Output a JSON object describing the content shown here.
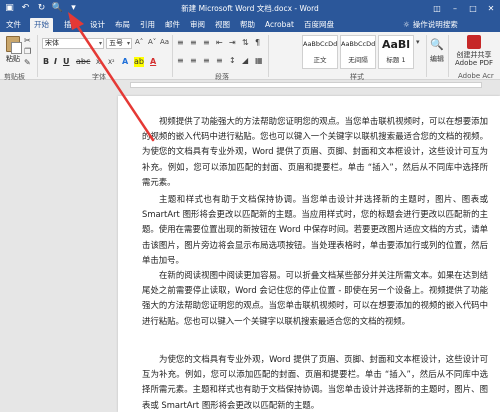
{
  "titlebar": {
    "title": "新建 Microsoft Word 文档.docx - Word",
    "qat": [
      "save-icon",
      "undo-icon",
      "redo-icon",
      "print-preview-icon",
      "customize-icon"
    ]
  },
  "tabs": [
    "文件",
    "开始",
    "插入",
    "设计",
    "布局",
    "引用",
    "邮件",
    "审阅",
    "视图",
    "帮助",
    "Acrobat",
    "百度网盘"
  ],
  "active_tab": "开始",
  "tell_me": "操作说明搜索",
  "ribbon": {
    "paste": "粘贴",
    "clipboard_group": "剪贴板",
    "font_name": "宋体",
    "font_size": "五号",
    "font_group": "字体",
    "paragraph_group": "段落",
    "styles": [
      {
        "sample": "AaBbCcDd",
        "name": "正文"
      },
      {
        "sample": "AaBbCcDd",
        "name": "无间隔"
      },
      {
        "sample": "AaBl",
        "name": "标题 1"
      }
    ],
    "styles_group": "样式",
    "edit_label": "编辑",
    "acrobat_label": "创建并共享 Adobe PDF",
    "acrobat_group": "Adobe Acr"
  },
  "colors": {
    "accent": "#2b579a",
    "arrow": "#e53935"
  },
  "document": {
    "paragraphs": [
      "视频提供了功能强大的方法帮助您证明您的观点。当您单击联机视频时，可以在想要添加的视频的嵌入代码中进行粘贴。您也可以键入一个关键字以联机搜索最适合您的文档的视频。为使您的文档具有专业外观，Word 提供了页眉、页脚、封面和文本框设计，这些设计可互为补充。例如，您可以添加匹配的封面、页眉和提要栏。单击 “插入”，然后从不同库中选择所需元素。",
      "主题和样式也有助于文档保持协调。当您单击设计并选择新的主题时，图片、图表或 SmartArt 图形将会更改以匹配新的主题。当应用样式时，您的标题会进行更改以匹配新的主题。使用在需要位置出现的新按钮在 Word 中保存时间。若要更改图片适应文档的方式，请单击该图片，图片旁边将会显示布局选项按钮。当处理表格时，单击要添加行或列的位置，然后单击加号。",
      "在新的阅读视图中阅读更加容易。可以折叠文档某些部分并关注所需文本。如果在达到结尾处之前需要停止读取，Word 会记住您的停止位置 - 即使在另一个设备上。视频提供了功能强大的方法帮助您证明您的观点。当您单击联机视频时，可以在想要添加的视频的嵌入代码中进行粘贴。您也可以键入一个关键字以联机搜索最适合您的文档的视频。",
      "为使您的文档具有专业外观，Word 提供了页眉、页脚、封面和文本框设计，这些设计可互为补充。例如，您可以添加匹配的封面、页眉和提要栏。单击 “插入”，然后从不同库中选择所需元素。主题和样式也有助于文档保持协调。当您单击设计并选择新的主题时，图片、图表或 SmartArt 图形将会更改以匹配新的主题。"
    ]
  }
}
